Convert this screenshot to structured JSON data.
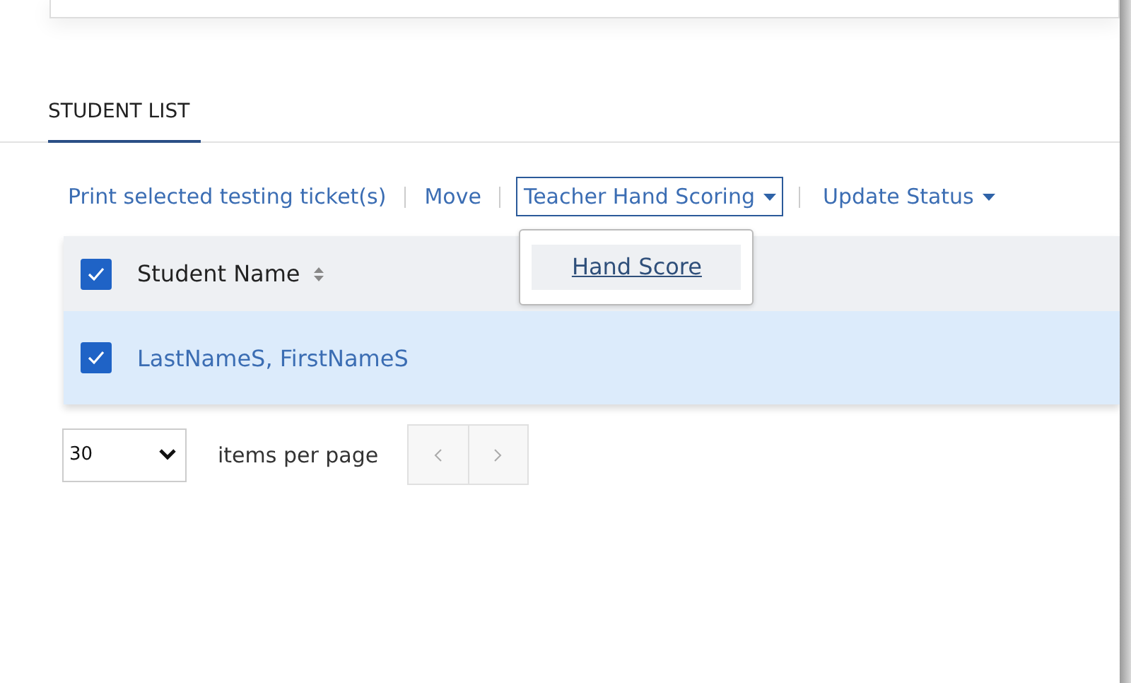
{
  "tabs": [
    {
      "label": "STUDENT LIST",
      "selected": true
    }
  ],
  "actions": [
    {
      "kind": "link",
      "label": "Print selected testing ticket(s)"
    },
    {
      "kind": "link",
      "label": "Move"
    },
    {
      "kind": "dropdown",
      "label": "Teacher Hand Scoring",
      "expanded": true,
      "menu": [
        "Hand Score"
      ]
    },
    {
      "kind": "dropdown",
      "label": "Update Status",
      "expanded": false
    }
  ],
  "table": {
    "select_all": {
      "checked": true
    },
    "columns": [
      {
        "label": "Student Name",
        "sortable": true
      }
    ],
    "rows": [
      {
        "name": "LastNameS, FirstNameS",
        "checked": true,
        "selected": true
      }
    ]
  },
  "pagination": {
    "page_size": "30",
    "label": "items per page"
  }
}
